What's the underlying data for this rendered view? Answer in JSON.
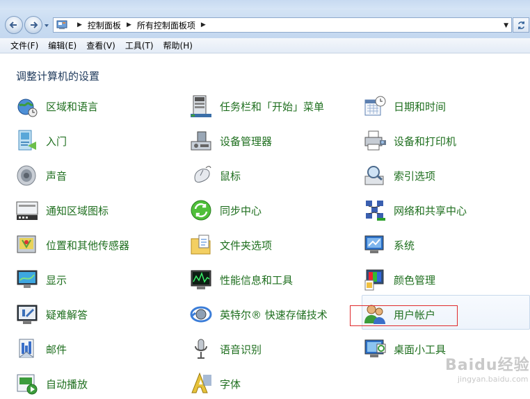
{
  "window": {
    "breadcrumbs": [
      "控制面板",
      "所有控制面板项"
    ]
  },
  "menu": [
    "文件(F)",
    "编辑(E)",
    "查看(V)",
    "工具(T)",
    "帮助(H)"
  ],
  "page_title": "调整计算机的设置",
  "items": [
    {
      "label": "区域和语言",
      "icon": "globe-clock-icon"
    },
    {
      "label": "任务栏和「开始」菜单",
      "icon": "taskbar-icon"
    },
    {
      "label": "日期和时间",
      "icon": "calendar-clock-icon"
    },
    {
      "label": "入门",
      "icon": "getting-started-icon"
    },
    {
      "label": "设备管理器",
      "icon": "device-manager-icon"
    },
    {
      "label": "设备和打印机",
      "icon": "printer-icon"
    },
    {
      "label": "声音",
      "icon": "speaker-icon"
    },
    {
      "label": "鼠标",
      "icon": "mouse-icon"
    },
    {
      "label": "索引选项",
      "icon": "index-search-icon"
    },
    {
      "label": "通知区域图标",
      "icon": "notification-tray-icon"
    },
    {
      "label": "同步中心",
      "icon": "sync-icon"
    },
    {
      "label": "网络和共享中心",
      "icon": "network-icon"
    },
    {
      "label": "位置和其他传感器",
      "icon": "location-sensor-icon"
    },
    {
      "label": "文件夹选项",
      "icon": "folder-options-icon"
    },
    {
      "label": "系统",
      "icon": "system-icon"
    },
    {
      "label": "显示",
      "icon": "display-icon"
    },
    {
      "label": "性能信息和工具",
      "icon": "performance-icon"
    },
    {
      "label": "颜色管理",
      "icon": "color-management-icon"
    },
    {
      "label": "疑难解答",
      "icon": "troubleshoot-icon"
    },
    {
      "label": "英特尔® 快速存储技术",
      "icon": "intel-storage-icon"
    },
    {
      "label": "用户帐户",
      "icon": "user-accounts-icon"
    },
    {
      "label": "邮件",
      "icon": "mail-icon"
    },
    {
      "label": "语音识别",
      "icon": "microphone-icon"
    },
    {
      "label": "桌面小工具",
      "icon": "gadgets-icon"
    },
    {
      "label": "自动播放",
      "icon": "autoplay-icon"
    },
    {
      "label": "字体",
      "icon": "fonts-icon"
    }
  ],
  "watermark": {
    "logo": "Baidu经验",
    "sub": "jingyan.baidu.com"
  }
}
